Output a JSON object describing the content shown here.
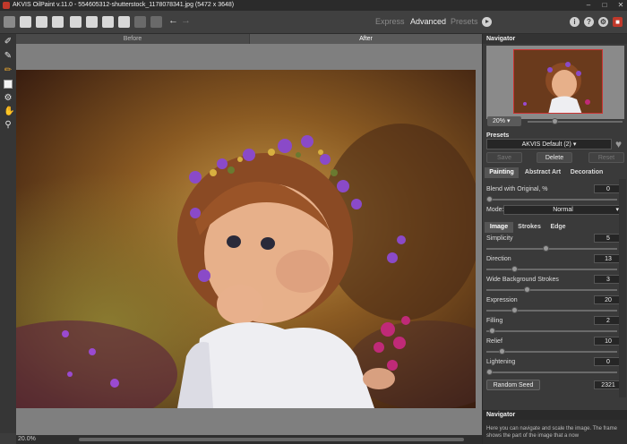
{
  "window": {
    "title": "AKVIS OilPaint v.11.0 - 554605312-shutterstock_1178078341.jpg (5472 x 3648)"
  },
  "modes": {
    "express": "Express",
    "advanced": "Advanced",
    "presets": "Presets"
  },
  "view_tabs": {
    "before": "Before",
    "after": "After"
  },
  "statusbar": {
    "zoom": "20.0%"
  },
  "navigator": {
    "title": "Navigator",
    "zoom": "20%",
    "zoom_slider_fraction": 0.27
  },
  "presets": {
    "title": "Presets",
    "selected": "AKVIS Default (2)",
    "save_label": "Save",
    "delete_label": "Delete",
    "reset_label": "Reset"
  },
  "tabs": {
    "painting": "Painting",
    "abstract_art": "Abstract Art",
    "decoration": "Decoration"
  },
  "blend": {
    "label": "Blend with Original, %",
    "value": "0",
    "fraction": 0.0
  },
  "mode": {
    "label": "Mode:",
    "value": "Normal"
  },
  "subtabs": {
    "image": "Image",
    "strokes": "Strokes",
    "edge": "Edge"
  },
  "params": [
    {
      "label": "Simplicity",
      "value": "5",
      "fraction": 0.45
    },
    {
      "label": "Direction",
      "value": "13",
      "fraction": 0.2
    },
    {
      "label": "Wide Background Strokes",
      "value": "3",
      "fraction": 0.3
    },
    {
      "label": "Expression",
      "value": "20",
      "fraction": 0.2
    },
    {
      "label": "Filling",
      "value": "2",
      "fraction": 0.02
    },
    {
      "label": "Relief",
      "value": "10",
      "fraction": 0.1
    },
    {
      "label": "Lightening",
      "value": "0",
      "fraction": 0.0
    }
  ],
  "seed": {
    "label": "Random Seed",
    "value": "2321"
  },
  "help": {
    "title": "Navigator",
    "text": "Here you can navigate and scale the image. The frame shows the part of the image that a now"
  },
  "colors": {
    "accent_red": "#c0392b",
    "panel_bg": "#3a3a3a",
    "canvas_bg": "#7f7f7f"
  },
  "icons": [
    "open-icon",
    "save-icon",
    "batch-icon",
    "print-icon",
    "share-icon",
    "settings-icon",
    "undo-icon",
    "redo-icon",
    "info-icon",
    "help-icon",
    "gear-icon",
    "akvis-logo-icon"
  ]
}
